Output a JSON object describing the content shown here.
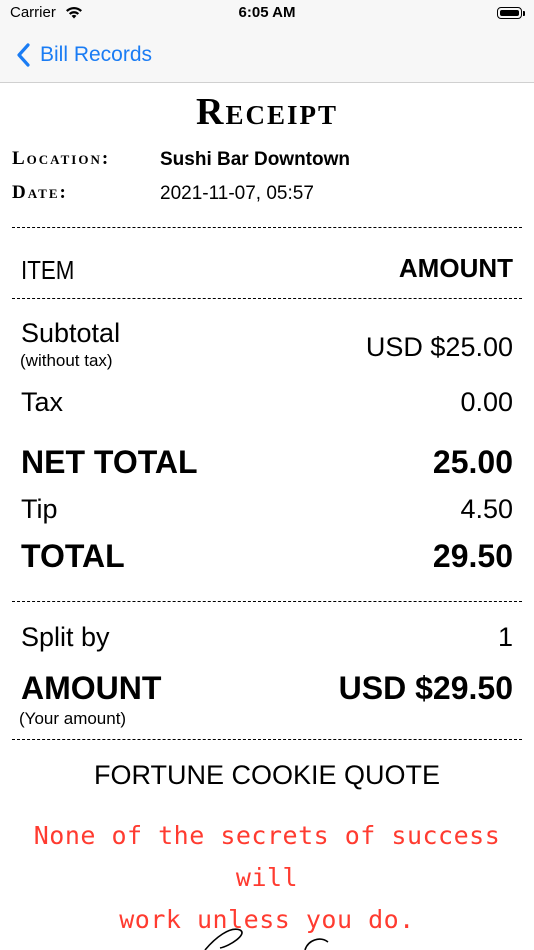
{
  "status_bar": {
    "carrier": "Carrier",
    "time": "6:05 AM"
  },
  "nav": {
    "back_label": "Bill Records"
  },
  "receipt": {
    "title": "Receipt",
    "location_label": "Location:",
    "location_value": "Sushi Bar Downtown",
    "date_label": "Date:",
    "date_value": "2021-11-07, 05:57",
    "header": {
      "item": "ITEM",
      "amount": "AMOUNT"
    },
    "subtotal": {
      "label": "Subtotal",
      "sublabel": "(without tax)",
      "value": "USD $25.00"
    },
    "tax": {
      "label": "Tax",
      "value": "0.00"
    },
    "net_total": {
      "label": "NET TOTAL",
      "value": "25.00"
    },
    "tip": {
      "label": "Tip",
      "value": "4.50"
    },
    "total": {
      "label": "TOTAL",
      "value": "29.50"
    },
    "split": {
      "label": "Split by",
      "value": "1"
    },
    "your_amount": {
      "label": "AMOUNT",
      "sublabel": "(Your amount)",
      "value": "USD $29.50"
    }
  },
  "fortune": {
    "title": "FORTUNE COOKIE QUOTE",
    "line1": "None of the secrets of success will",
    "line2": "work unless you do."
  },
  "colors": {
    "accent": "#1a7cf4",
    "quote": "#ff3b30"
  },
  "icons": {
    "back": "chevron-left-icon",
    "wifi": "wifi-icon",
    "battery": "battery-icon"
  }
}
